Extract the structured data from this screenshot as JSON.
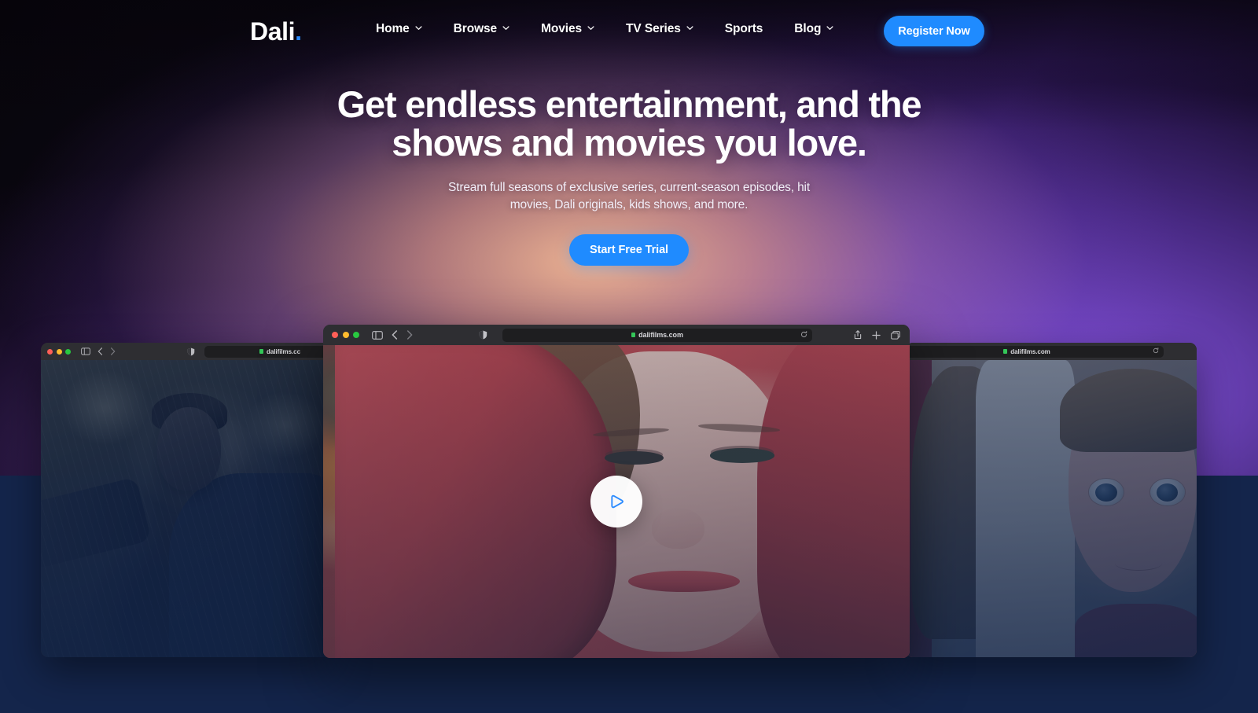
{
  "header": {
    "logo_text": "Dali",
    "logo_dot": ".",
    "nav_items": [
      {
        "label": "Home",
        "has_chevron": true,
        "icon": "chevron-down-icon"
      },
      {
        "label": "Browse",
        "has_chevron": true,
        "icon": "chevron-down-icon"
      },
      {
        "label": "Movies",
        "has_chevron": true,
        "icon": "chevron-down-icon"
      },
      {
        "label": "TV Series",
        "has_chevron": true,
        "icon": "chevron-down-icon"
      },
      {
        "label": "Sports",
        "has_chevron": false,
        "icon": ""
      },
      {
        "label": "Blog",
        "has_chevron": true,
        "icon": "chevron-down-icon"
      }
    ],
    "register_label": "Register Now"
  },
  "hero": {
    "title": "Get endless entertainment, and the shows and movies you love.",
    "subtitle": "Stream full seasons of exclusive series, current-season episodes, hit movies, Dali originals, kids shows, and more.",
    "cta_label": "Start Free Trial"
  },
  "browser_windows": {
    "left": {
      "url": "dalifilms.cc",
      "traffic_lights": [
        "close-red",
        "minimize-yellow",
        "maximize-green"
      ],
      "icons": [
        "sidebar-toggle-icon",
        "back-icon",
        "forward-icon",
        "shield-icon",
        "lock-icon"
      ],
      "artwork": "dark-warrior-in-rain"
    },
    "center": {
      "url": "dalifilms.com",
      "traffic_lights": [
        "close-red",
        "minimize-yellow",
        "maximize-green"
      ],
      "icons": [
        "sidebar-toggle-icon",
        "back-icon",
        "forward-icon",
        "shield-icon",
        "lock-icon",
        "reload-icon",
        "share-icon",
        "new-tab-icon",
        "tab-overview-icon"
      ],
      "artwork": "woman-in-red-scarf",
      "play_button_label": "play-video"
    },
    "right": {
      "url": "dalifilms.com",
      "traffic_lights": [
        "close-red",
        "minimize-yellow",
        "maximize-green"
      ],
      "icons": [
        "lock-icon",
        "reload-icon"
      ],
      "artwork": "creepy-dolls"
    }
  },
  "colors": {
    "accent_blue": "#1f8bff",
    "logo_dot_blue": "#2b8bff",
    "navy_band": "#14254b",
    "chrome_bar": "#2e2e32",
    "url_field": "#1e1e20",
    "text_white": "#ffffff",
    "lock_green": "#34c759",
    "light_red": "#ff5f57",
    "light_yellow": "#febc2e",
    "light_green": "#28c840"
  }
}
